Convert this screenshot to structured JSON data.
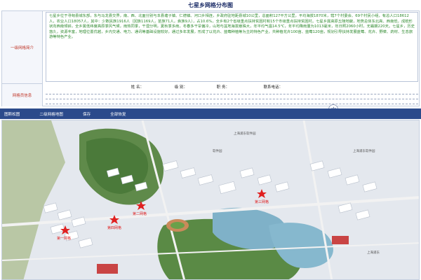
{
  "page": {
    "title": "七星乡网格分布图"
  },
  "labels": {
    "intro": "一级网格简介",
    "staff": "网格员信息"
  },
  "intro_text": "七星乡位于寻甸县城东部，东与马龙县交界，南、西、北面分别与本县塘子镇、仁德镇、河口乡相连，乡政府驻地距县城10公里，总面积127平方公里，平均海拔1870米，辖7个村委会、69个村民小组，有总人口18612人，农业人口18057人，其中：少数民族1916人（回族1169人，苗族71人，彝族9人），占10.6%，全乡有2个省级重点扶持贫困村和15个市级重点扶持贫困村。七星乡属高原丘陵地貌，地势总体东北高、西南低，成梳形状向西南倾斜，全乡属低纬度高原季风气候，雨热同季，干湿分明，夏秋季多雨，冬春多干旱偏冷，山地与盆地海拔悬殊大，年平均气温14.5℃，年平均降雨量为1013毫米，年日照2060小时，无霜期220天。七星乡，历史悠久，资源丰富，地理位置优越，乡内交通、电力、通讯等基础设施较好，通过多年发展，形成了以花卉、蓝莓种植等为主的特色产业，共种植花卉100亩、蓝莓120亩，规划引导扶持发展蓝莓、花卉、野菜、药材、生态旅游等特色产业。",
  "staff": {
    "name_label": "姓 名：",
    "rank_label": "级 别：",
    "job_label": "职 务：",
    "phone_label": "联系电话："
  },
  "toolbar": {
    "items": [
      "图斯松图",
      "二级网格地图",
      "保存",
      "全部恢复"
    ]
  },
  "map": {
    "markers": [
      "第一网格",
      "第二网格",
      "第三网格",
      "第四网格"
    ],
    "road_labels": [
      "上海浦东软件园",
      "上海浦东软件园",
      "软件园",
      "上海浦东"
    ]
  },
  "colors": {
    "toolbar": "#2b4a8b",
    "intro_text": "#2f8a2f",
    "label": "#c0392b",
    "marker": "#e02020"
  }
}
